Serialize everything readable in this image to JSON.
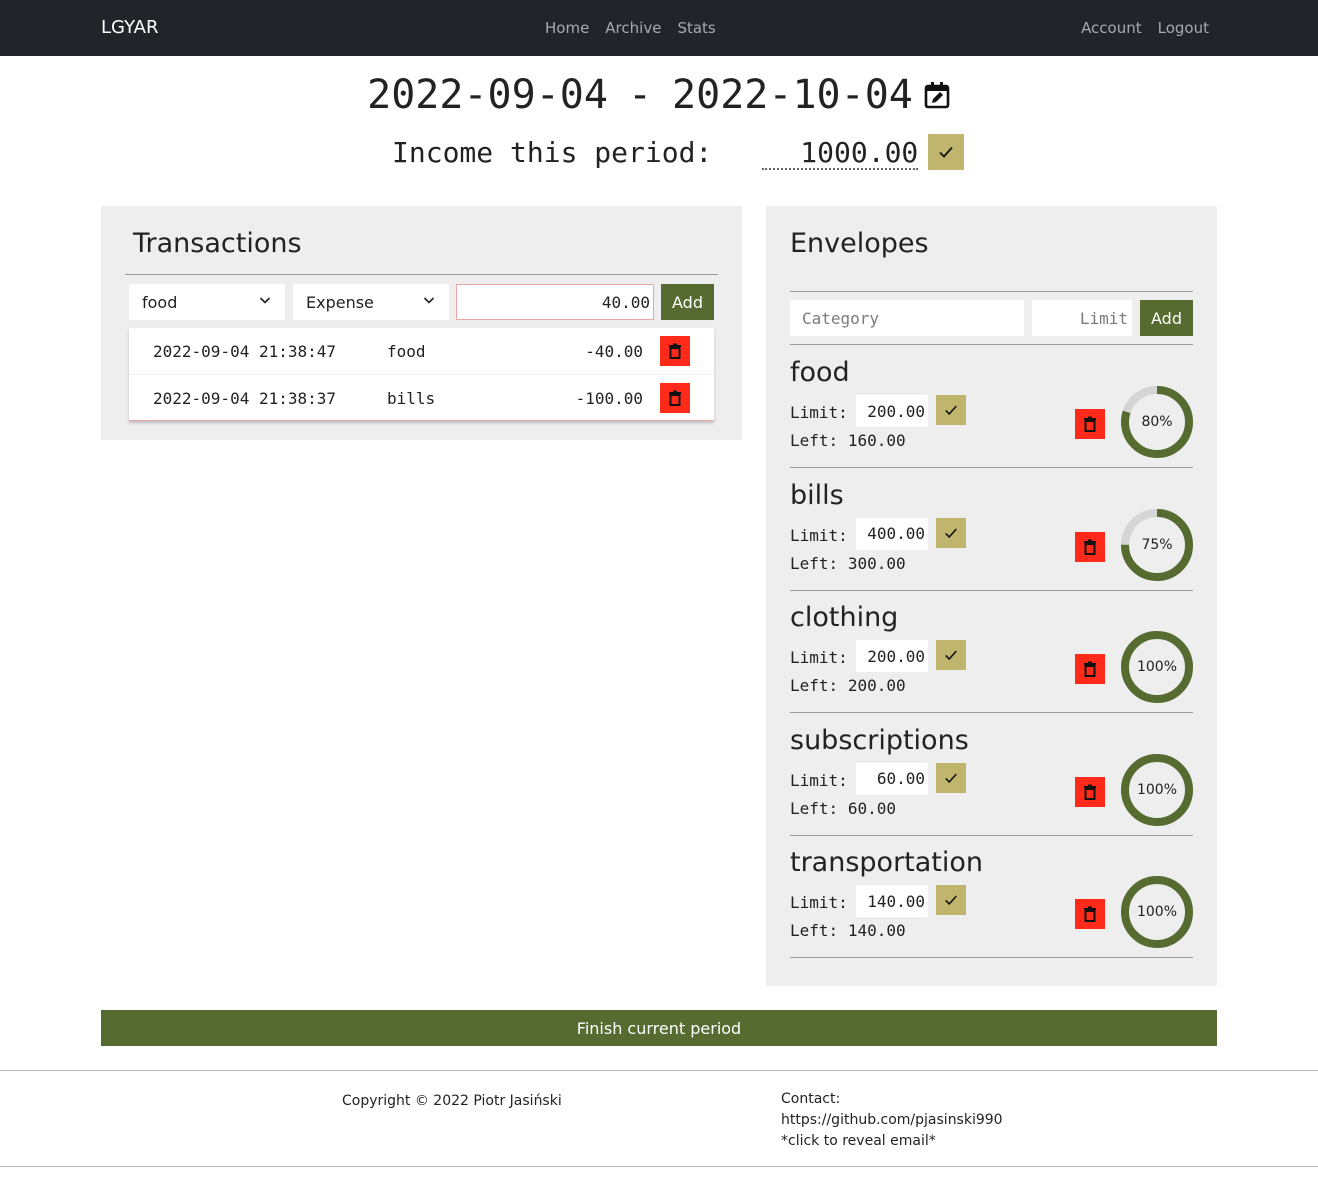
{
  "nav": {
    "brand": "LGYAR",
    "center": [
      "Home",
      "Archive",
      "Stats"
    ],
    "right": [
      "Account",
      "Logout"
    ]
  },
  "period": {
    "start": "2022-09-04",
    "separator": "-",
    "end": "2022-10-04",
    "edit_icon": "calendar-edit-icon",
    "income_label": "Income this period:",
    "income_value": "1000.00"
  },
  "transactions": {
    "title": "Transactions",
    "category_selected": "food",
    "type_selected": "Expense",
    "amount_value": "40.00",
    "add_label": "Add",
    "rows": [
      {
        "date": "2022-09-04 21:38:47",
        "category": "food",
        "amount": "-40.00"
      },
      {
        "date": "2022-09-04 21:38:37",
        "category": "bills",
        "amount": "-100.00"
      }
    ]
  },
  "envelopes": {
    "title": "Envelopes",
    "category_placeholder": "Category",
    "limit_placeholder": "Limit",
    "add_label": "Add",
    "limit_label": "Limit:",
    "left_label": "Left:",
    "items": [
      {
        "name": "food",
        "limit": "200.00",
        "left": "160.00",
        "percent_label": "80%",
        "percent": 80
      },
      {
        "name": "bills",
        "limit": "400.00",
        "left": "300.00",
        "percent_label": "75%",
        "percent": 75
      },
      {
        "name": "clothing",
        "limit": "200.00",
        "left": "200.00",
        "percent_label": "100%",
        "percent": 100
      },
      {
        "name": "subscriptions",
        "limit": "60.00",
        "left": "60.00",
        "percent_label": "100%",
        "percent": 100
      },
      {
        "name": "transportation",
        "limit": "140.00",
        "left": "140.00",
        "percent_label": "100%",
        "percent": 100
      }
    ]
  },
  "finish_label": "Finish current period",
  "footer": {
    "copyright": "Copyright © 2022 Piotr Jasiński",
    "contact_title": "Contact:",
    "github": "https://github.com/pjasinski990",
    "reveal_email": "*click to reveal email*"
  },
  "colors": {
    "navbar": "#212529",
    "accent": "#556b2f",
    "check": "#bfb56d",
    "delete": "#ff2a1a",
    "panel": "#eeeeee",
    "donut_track": "#d5d5d5"
  }
}
